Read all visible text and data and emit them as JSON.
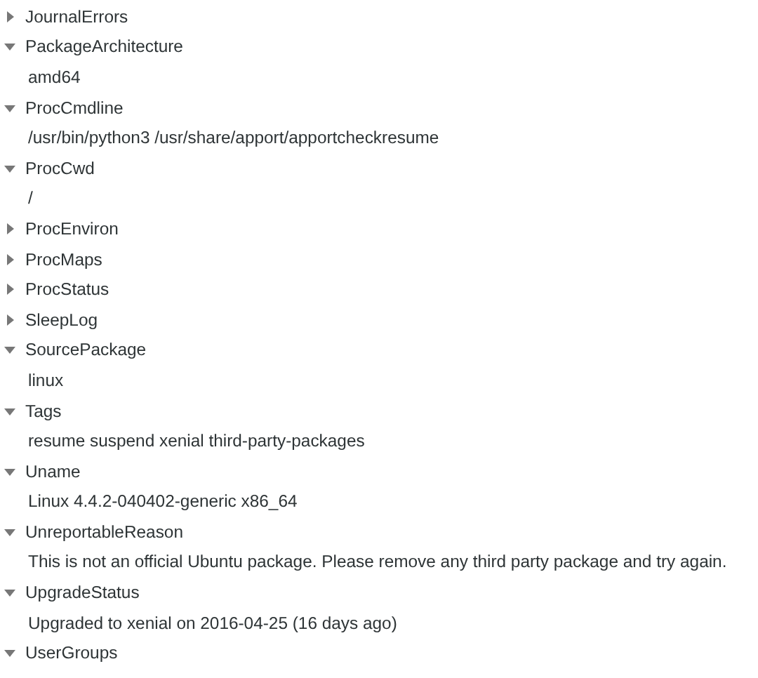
{
  "tree": {
    "items": [
      {
        "label": "JournalErrors",
        "expanded": false
      },
      {
        "label": "PackageArchitecture",
        "expanded": true,
        "children": [
          {
            "label": "amd64"
          }
        ]
      },
      {
        "label": "ProcCmdline",
        "expanded": true,
        "children": [
          {
            "label": "/usr/bin/python3 /usr/share/apport/apportcheckresume"
          }
        ]
      },
      {
        "label": "ProcCwd",
        "expanded": true,
        "children": [
          {
            "label": "/"
          }
        ]
      },
      {
        "label": "ProcEnviron",
        "expanded": false
      },
      {
        "label": "ProcMaps",
        "expanded": false
      },
      {
        "label": "ProcStatus",
        "expanded": false
      },
      {
        "label": "SleepLog",
        "expanded": false
      },
      {
        "label": "SourcePackage",
        "expanded": true,
        "children": [
          {
            "label": "linux"
          }
        ]
      },
      {
        "label": "Tags",
        "expanded": true,
        "children": [
          {
            "label": "resume suspend xenial third-party-packages"
          }
        ]
      },
      {
        "label": "Uname",
        "expanded": true,
        "children": [
          {
            "label": "Linux 4.4.2-040402-generic x86_64"
          }
        ]
      },
      {
        "label": "UnreportableReason",
        "expanded": true,
        "children": [
          {
            "label": "This is not an official Ubuntu package. Please remove any third party package and try again."
          }
        ]
      },
      {
        "label": "UpgradeStatus",
        "expanded": true,
        "children": [
          {
            "label": "Upgraded to xenial on 2016-04-25 (16 days ago)"
          }
        ]
      },
      {
        "label": "UserGroups",
        "expanded": true
      }
    ]
  }
}
